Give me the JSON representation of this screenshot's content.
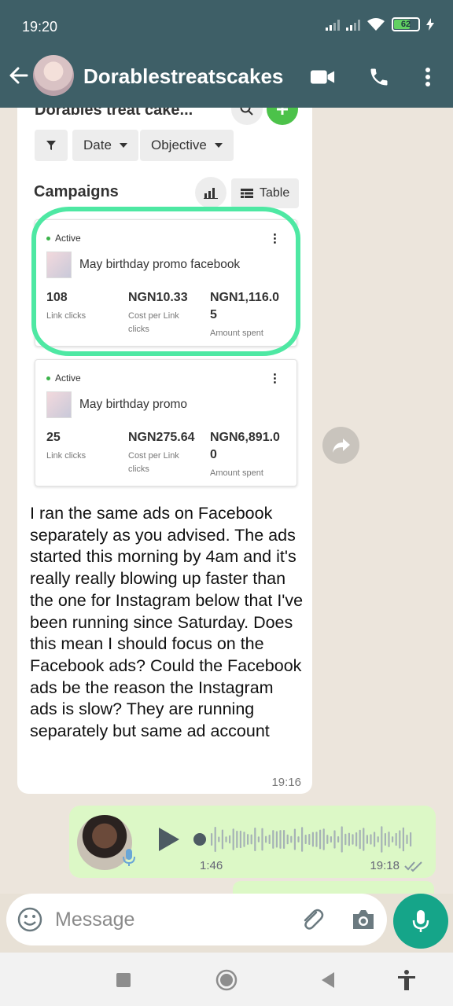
{
  "status_bar": {
    "time": "19:20",
    "battery": "62"
  },
  "header": {
    "contact_name": "Dorablestreatscakes"
  },
  "screenshot": {
    "account_name": "Dorables treat cake...",
    "filters": {
      "date": "Date",
      "objective": "Objective"
    },
    "section_title": "Campaigns",
    "table_label": "Table",
    "campaigns": [
      {
        "status": "Active",
        "name": "May birthday promo facebook",
        "link_clicks": "108",
        "link_clicks_label": "Link clicks",
        "cost_per_click": "NGN10.33",
        "cost_per_click_label_1": "Cost per Link",
        "cost_per_click_label_2": "clicks",
        "amount_spent_1": "NGN1,116.0",
        "amount_spent_2": "5",
        "amount_spent_label": "Amount spent"
      },
      {
        "status": "Active",
        "name": "May birthday promo",
        "link_clicks": "25",
        "link_clicks_label": "Link clicks",
        "cost_per_click": "NGN275.64",
        "cost_per_click_label_1": "Cost per Link",
        "cost_per_click_label_2": "clicks",
        "amount_spent_1": "NGN6,891.0",
        "amount_spent_2": "0",
        "amount_spent_label": "Amount spent"
      }
    ]
  },
  "message": {
    "text": "I ran the same ads on Facebook separately as you advised. The ads started this morning by 4am and it's really really blowing  up faster than the one for Instagram below that I've been running since Saturday.  Does this mean I should focus on the Facebook ads? Could the Facebook ads be the reason the Instagram ads is slow? They are running separately but same ad account",
    "time": "19:16"
  },
  "voice_note": {
    "duration": "1:46",
    "time": "19:18"
  },
  "input": {
    "placeholder": "Message"
  },
  "colors": {
    "header": "#3e5f67",
    "accent_green": "#15a589",
    "outgoing_bubble": "#dcf8c6",
    "highlight": "#4ee8a3"
  }
}
